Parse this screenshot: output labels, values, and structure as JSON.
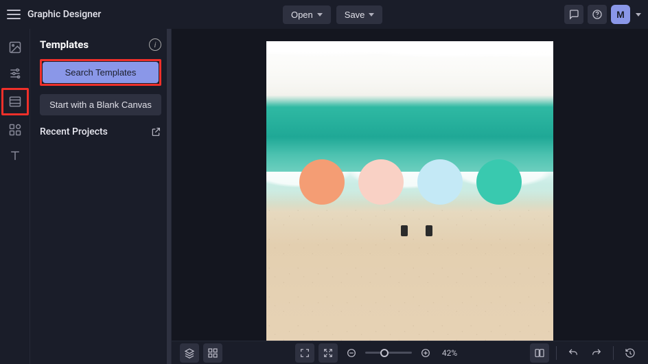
{
  "app": {
    "title": "Graphic Designer"
  },
  "topbar": {
    "open_label": "Open",
    "save_label": "Save",
    "avatar_initial": "M"
  },
  "panel": {
    "title": "Templates",
    "search_label": "Search Templates",
    "blank_label": "Start with a Blank Canvas",
    "recent_label": "Recent Projects"
  },
  "canvas": {
    "swatches": [
      {
        "color": "#f49d74"
      },
      {
        "color": "#f9d1c5"
      },
      {
        "color": "#c4e9f6"
      },
      {
        "color": "#39c9af"
      }
    ]
  },
  "zoom": {
    "label": "42%"
  }
}
